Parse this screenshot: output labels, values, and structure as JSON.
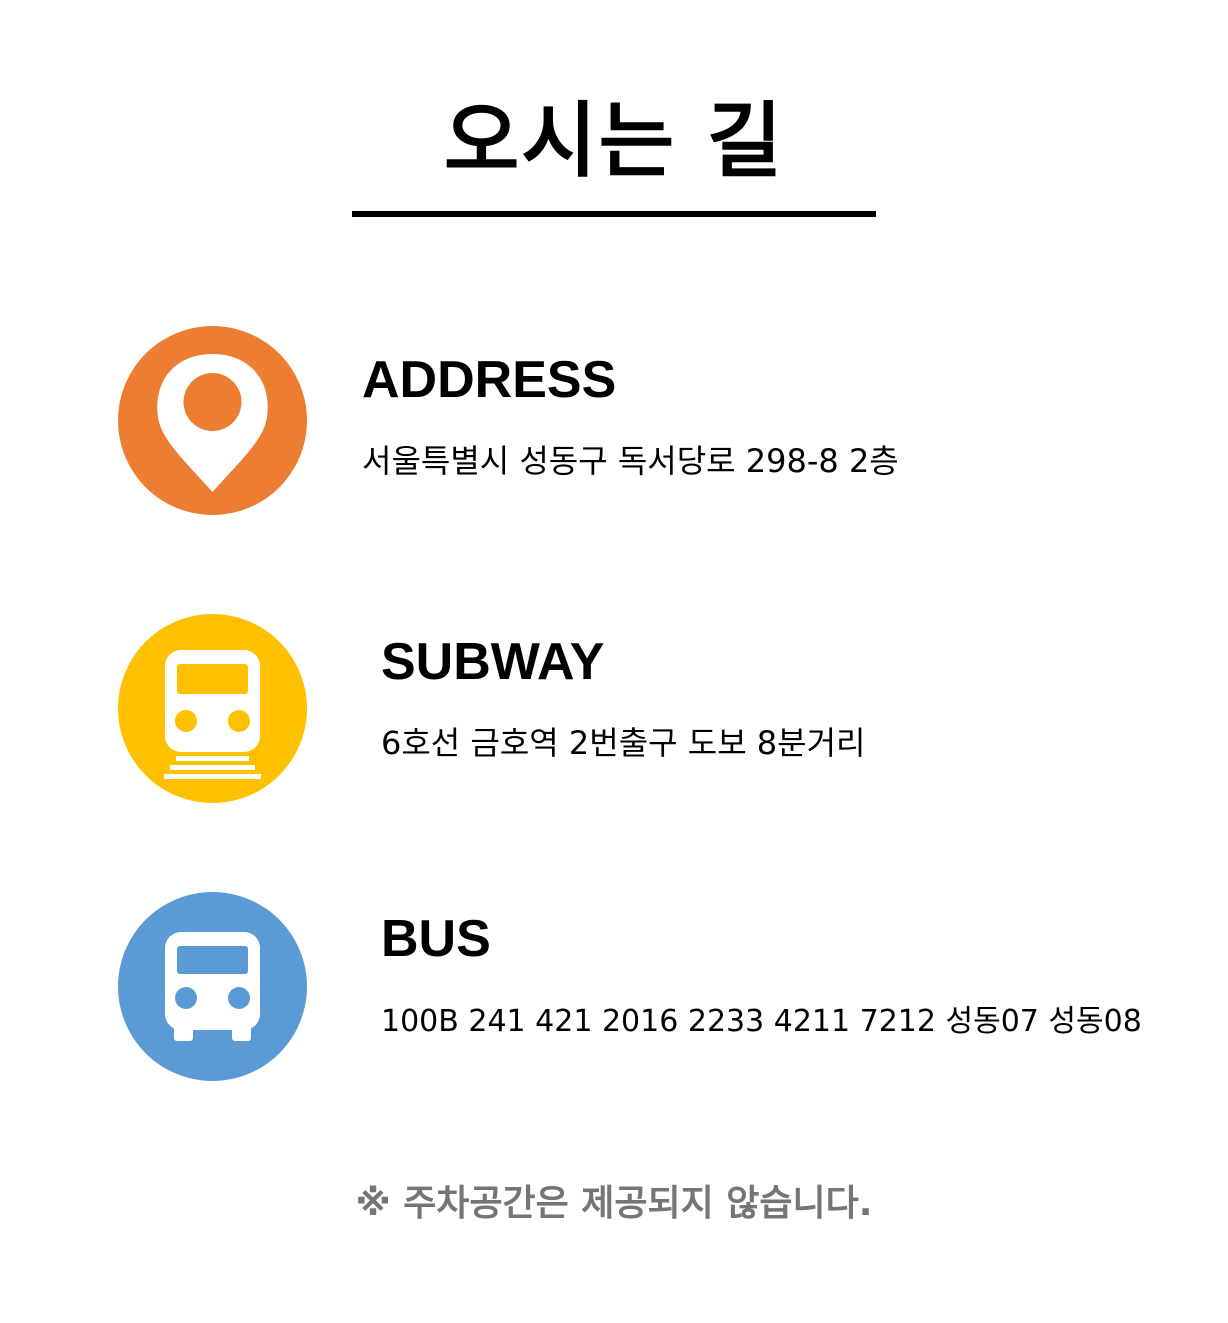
{
  "title": "오시는 길",
  "colors": {
    "address": "#ED7D31",
    "subway": "#FFC000",
    "bus": "#5B9BD5",
    "notice": "#757575"
  },
  "sections": [
    {
      "icon": "map-pin-icon",
      "heading": "ADDRESS",
      "detail": "서울특별시 성동구 독서당로 298-8 2층"
    },
    {
      "icon": "train-icon",
      "heading": "SUBWAY",
      "detail": "6호선 금호역 2번출구 도보 8분거리"
    },
    {
      "icon": "bus-icon",
      "heading": "BUS",
      "detail": "100B 241 421 2016 2233 4211 7212 성동07 성동08"
    }
  ],
  "notice": "※ 주차공간은 제공되지 않습니다."
}
